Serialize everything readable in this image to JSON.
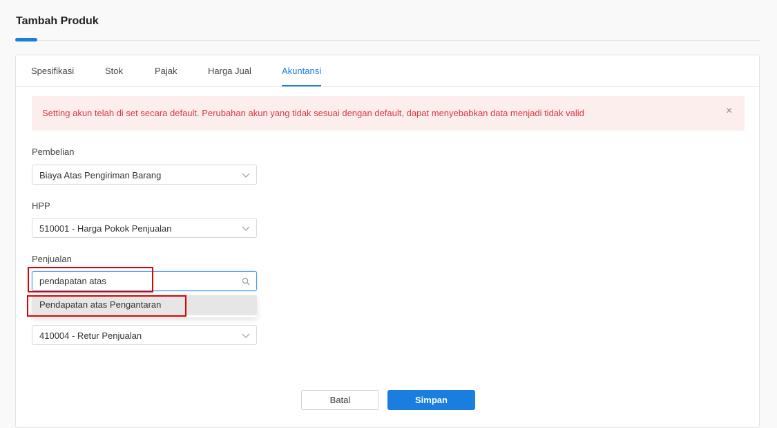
{
  "page": {
    "title": "Tambah Produk"
  },
  "tabs": [
    {
      "label": "Spesifikasi"
    },
    {
      "label": "Stok"
    },
    {
      "label": "Pajak"
    },
    {
      "label": "Harga Jual"
    },
    {
      "label": "Akuntansi"
    }
  ],
  "active_tab": "Akuntansi",
  "alert": {
    "message": "Setting akun telah di set secara default. Perubahan akun yang tidak sesuai dengan default, dapat menyebabkan data menjadi tidak valid",
    "close_symbol": "×"
  },
  "fields": {
    "pembelian": {
      "label": "Pembelian",
      "value": "Biaya Atas Pengiriman Barang"
    },
    "hpp": {
      "label": "HPP",
      "value": "510001 - Harga Pokok Penjualan"
    },
    "penjualan": {
      "label": "Penjualan",
      "search_value": "pendapatan atas"
    },
    "retur": {
      "value": "410004 - Retur Penjualan"
    }
  },
  "dropdown": {
    "options": [
      {
        "label": "Pendapatan atas Pengantaran"
      }
    ]
  },
  "buttons": {
    "cancel": "Batal",
    "save": "Simpan"
  },
  "colors": {
    "accent": "#1a7ee0",
    "alert_text": "#d9363e",
    "alert_bg": "#fdeeee",
    "annotation": "#e00000"
  },
  "icons": {
    "chevron": "chevron-down-icon",
    "search": "search-icon",
    "close": "close-icon"
  }
}
